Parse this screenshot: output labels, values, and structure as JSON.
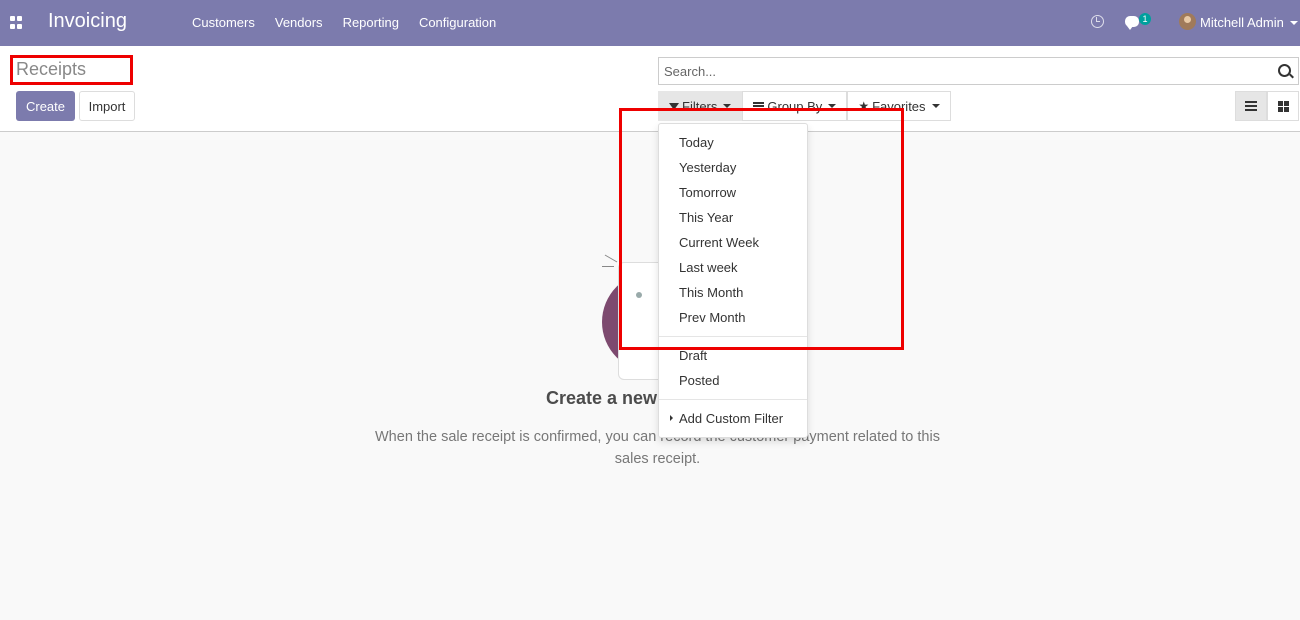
{
  "navbar": {
    "brand": "Invoicing",
    "menu": [
      "Customers",
      "Vendors",
      "Reporting",
      "Configuration"
    ],
    "chat_badge": "1",
    "user_name": "Mitchell Admin",
    "color": "#7c7bad"
  },
  "control_panel": {
    "title": "Receipts",
    "create_label": "Create",
    "import_label": "Import",
    "search_placeholder": "Search...",
    "filters_label": "Filters",
    "group_by_label": "Group By",
    "favorites_label": "Favorites"
  },
  "filters_dropdown": {
    "date_items": [
      "Today",
      "Yesterday",
      "Tomorrow",
      "This Year",
      "Current Week",
      "Last week",
      "This Month",
      "Prev Month"
    ],
    "state_items": [
      "Draft",
      "Posted"
    ],
    "custom_label": "Add Custom Filter"
  },
  "empty_state": {
    "title": "Create a new",
    "help_line1": "When the sale receipt is confirmed, you can record the customer payment related to this",
    "help_line2": "sales receipt."
  },
  "colors": {
    "primary": "#7c7bad",
    "highlight": "#ee0000",
    "illustration": "#7d4a6f"
  }
}
